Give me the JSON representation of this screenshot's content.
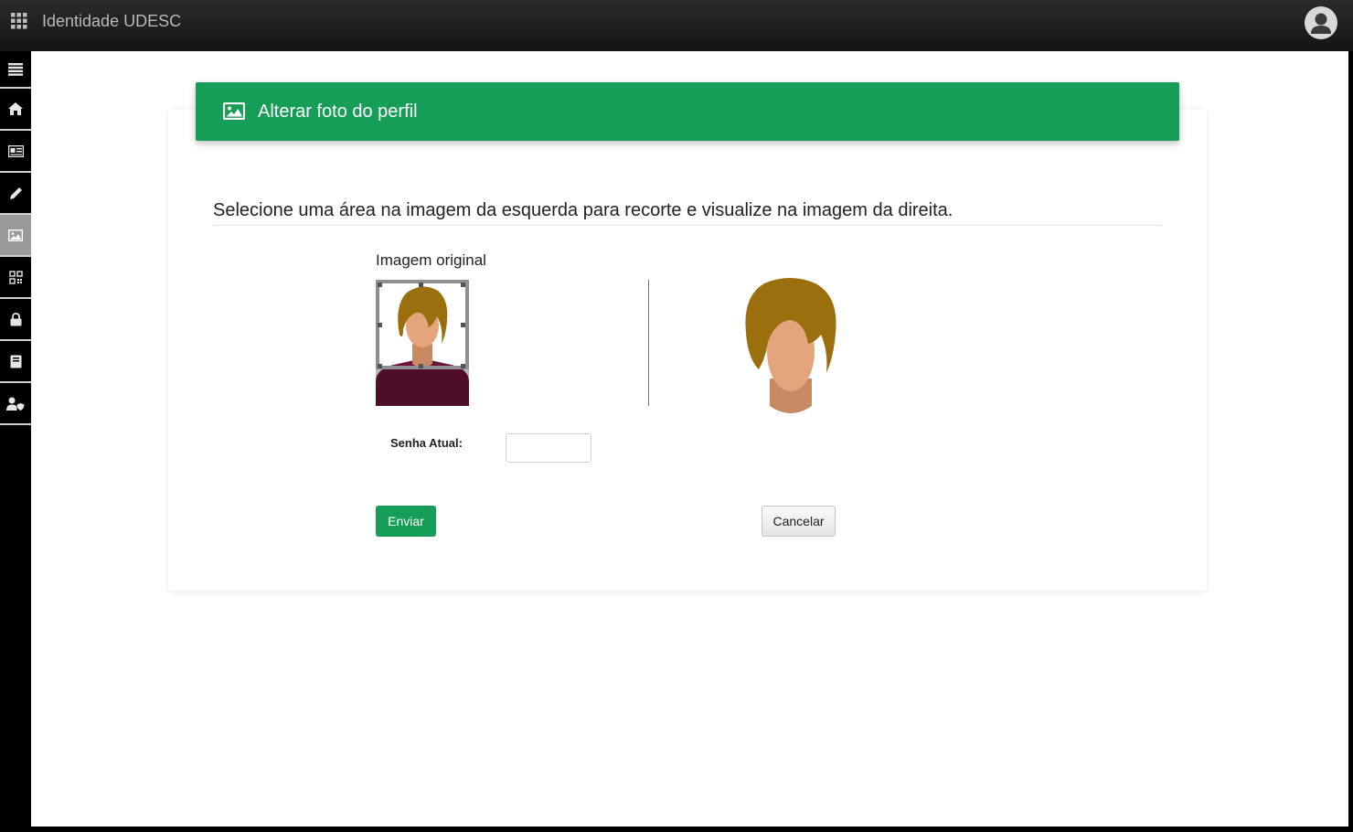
{
  "app": {
    "title": "Identidade UDESC"
  },
  "sidebar": {
    "items": [
      {
        "icon": "menu-icon"
      },
      {
        "icon": "home-icon"
      },
      {
        "icon": "id-card-icon"
      },
      {
        "icon": "pencil-icon"
      },
      {
        "icon": "image-icon",
        "active": true
      },
      {
        "icon": "qr-code-icon"
      },
      {
        "icon": "lock-icon"
      },
      {
        "icon": "book-icon"
      },
      {
        "icon": "user-shield-icon"
      }
    ]
  },
  "card": {
    "title": "Alterar foto do perfil",
    "instruction": "Selecione uma área na imagem da esquerda para recorte e visualize na imagem da direita.",
    "original_label": "Imagem original",
    "password_label": "Senha Atual:",
    "password_value": "",
    "send_label": "Enviar",
    "cancel_label": "Cancelar"
  },
  "colors": {
    "accent": "#169d57",
    "hair": "#9b6f0e",
    "skin": "#e4a57c",
    "shirt": "#6e1438"
  }
}
